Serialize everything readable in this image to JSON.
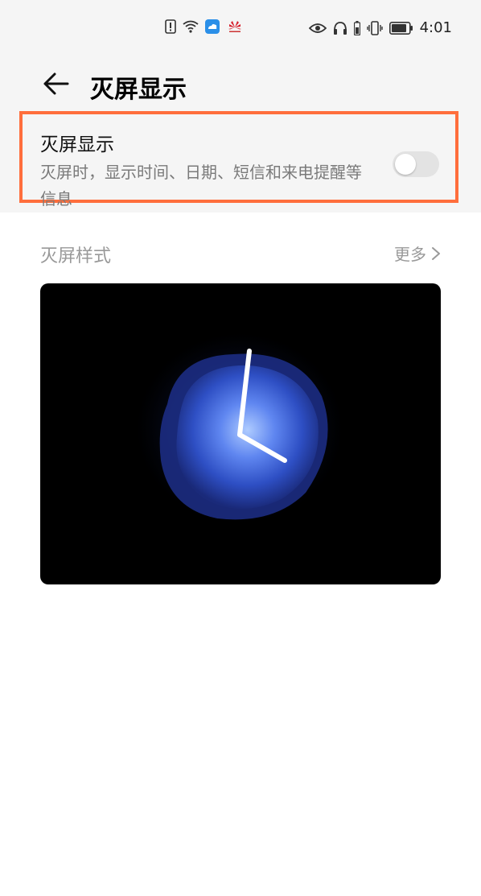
{
  "status_bar": {
    "time": "4:01",
    "center_icons": [
      "sim-alert-icon",
      "wifi-icon",
      "cloud-icon",
      "huawei-logo-icon"
    ],
    "right_icons": [
      "eye-icon",
      "headphones-icon",
      "battery-small-icon",
      "vibrate-icon",
      "battery-icon"
    ]
  },
  "header": {
    "title": "灭屏显示"
  },
  "aod_setting": {
    "title": "灭屏显示",
    "description": "灭屏时，显示时间、日期、短信和来电提醒等信息",
    "enabled": false,
    "highlight_color": "#ff6e3c"
  },
  "style_section": {
    "title": "灭屏样式",
    "more_label": "更多"
  },
  "preview": {
    "background": "#000000",
    "hour_hand_direction": "up",
    "minute_hand_direction": "lower-right"
  }
}
